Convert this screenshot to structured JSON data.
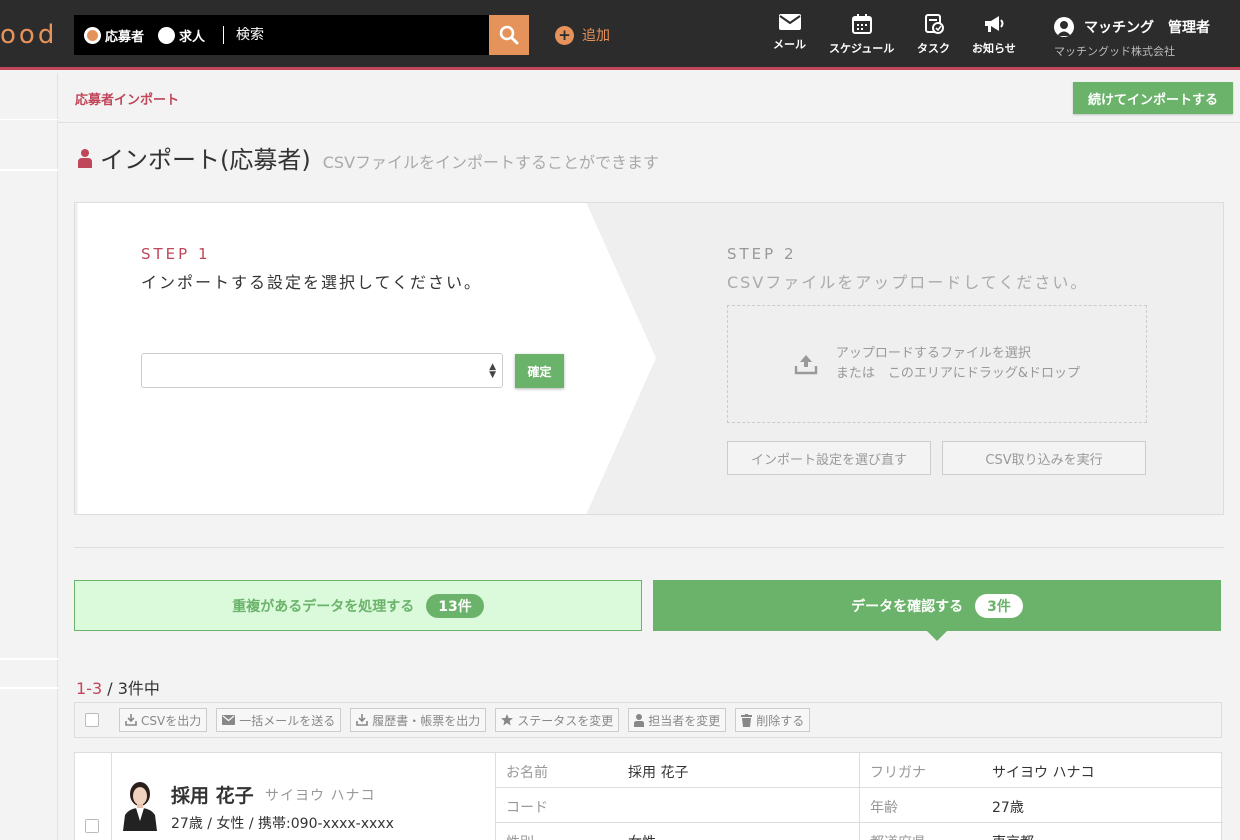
{
  "header": {
    "logo_text": "ood",
    "search": {
      "radio_applicant": "応募者",
      "radio_job": "求人",
      "placeholder": "検索"
    },
    "add_label": "追加",
    "nav": [
      {
        "label": "メール",
        "icon": "mail-icon"
      },
      {
        "label": "スケジュール",
        "icon": "calendar-icon"
      },
      {
        "label": "タスク",
        "icon": "task-icon"
      },
      {
        "label": "お知らせ",
        "icon": "megaphone-icon"
      }
    ],
    "user": {
      "name": "マッチング　管理者",
      "company": "マッチングッド株式会社"
    }
  },
  "subbar": {
    "breadcrumb": "応募者インポート",
    "continue_label": "続けてインポートする"
  },
  "page": {
    "title": "インポート(応募者)",
    "subtitle": "CSVファイルをインポートすることができます"
  },
  "step1": {
    "label": "STEP 1",
    "desc": "インポートする設定を選択してください。",
    "select_value": "",
    "confirm_label": "確定"
  },
  "step2": {
    "label": "STEP 2",
    "desc": "CSVファイルをアップロードしてください。",
    "drop_line1": "アップロードするファイルを選択",
    "drop_line2": "または　このエリアにドラッグ&ドロップ",
    "reselect_label": "インポート設定を選び直す",
    "execute_label": "CSV取り込みを実行"
  },
  "tabs": [
    {
      "label": "重複があるデータを処理する",
      "count": "13件",
      "active": false
    },
    {
      "label": "データを確認する",
      "count": "3件",
      "active": true
    }
  ],
  "results": {
    "range": "1-3",
    "total": " / 3件中"
  },
  "toolbar": [
    {
      "label": "CSVを出力",
      "icon": "download-icon"
    },
    {
      "label": "一括メールを送る",
      "icon": "mail-icon"
    },
    {
      "label": "履歴書・帳票を出力",
      "icon": "download-icon"
    },
    {
      "label": "ステータスを変更",
      "icon": "star-icon"
    },
    {
      "label": "担当者を変更",
      "icon": "person-icon"
    },
    {
      "label": "削除する",
      "icon": "trash-icon"
    }
  ],
  "record": {
    "name": "採用 花子",
    "kana": "サイヨウ ハナコ",
    "detail": "27歳 / 女性 / 携帯:090-xxxx-xxxx",
    "fields": [
      {
        "l1": "お名前",
        "v1": "採用 花子",
        "l2": "フリガナ",
        "v2": "サイヨウ ハナコ"
      },
      {
        "l1": "コード",
        "v1": "",
        "l2": "年齢",
        "v2": "27歳"
      },
      {
        "l1": "性別",
        "v1": "女性",
        "l2": "都道府県",
        "v2": "東京都"
      }
    ]
  },
  "colors": {
    "accent_orange": "#e5925b",
    "accent_red": "#c0465a",
    "green": "#6bb36a",
    "dark_header": "#2c2c2c"
  }
}
